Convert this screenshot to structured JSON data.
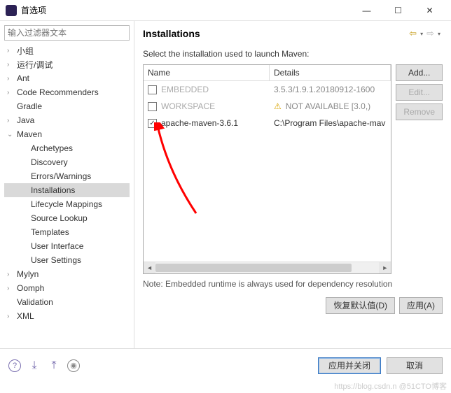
{
  "window": {
    "title": "首选项"
  },
  "filter": {
    "placeholder": "输入过滤器文本"
  },
  "tree": [
    {
      "label": "小组",
      "arrow": "›"
    },
    {
      "label": "运行/调试",
      "arrow": "›"
    },
    {
      "label": "Ant",
      "arrow": "›"
    },
    {
      "label": "Code Recommenders",
      "arrow": "›"
    },
    {
      "label": "Gradle",
      "arrow": ""
    },
    {
      "label": "Java",
      "arrow": "›"
    },
    {
      "label": "Maven",
      "arrow": "⌄",
      "children": [
        {
          "label": "Archetypes"
        },
        {
          "label": "Discovery"
        },
        {
          "label": "Errors/Warnings"
        },
        {
          "label": "Installations",
          "selected": true
        },
        {
          "label": "Lifecycle Mappings"
        },
        {
          "label": "Source Lookup"
        },
        {
          "label": "Templates"
        },
        {
          "label": "User Interface"
        },
        {
          "label": "User Settings"
        }
      ]
    },
    {
      "label": "Mylyn",
      "arrow": "›"
    },
    {
      "label": "Oomph",
      "arrow": "›"
    },
    {
      "label": "Validation",
      "arrow": ""
    },
    {
      "label": "XML",
      "arrow": "›"
    }
  ],
  "panel": {
    "heading": "Installations",
    "desc": "Select the installation used to launch Maven:",
    "columns": {
      "name": "Name",
      "details": "Details"
    },
    "rows": [
      {
        "checked": false,
        "name": "EMBEDDED",
        "details": "3.5.3/1.9.1.20180912-1600",
        "dim": true
      },
      {
        "checked": false,
        "name": "WORKSPACE",
        "details": "NOT AVAILABLE [3.0,)",
        "dim": true,
        "warn": true
      },
      {
        "checked": true,
        "name": "apache-maven-3.6.1",
        "details": "C:\\Program Files\\apache-mav"
      }
    ],
    "buttons": {
      "add": "Add...",
      "edit": "Edit...",
      "remove": "Remove"
    },
    "note": "Note: Embedded runtime is always used for dependency resolution",
    "restore": "恢复默认值(D)",
    "apply": "应用(A)"
  },
  "footer": {
    "applyClose": "应用并关闭",
    "cancel": "取消"
  }
}
